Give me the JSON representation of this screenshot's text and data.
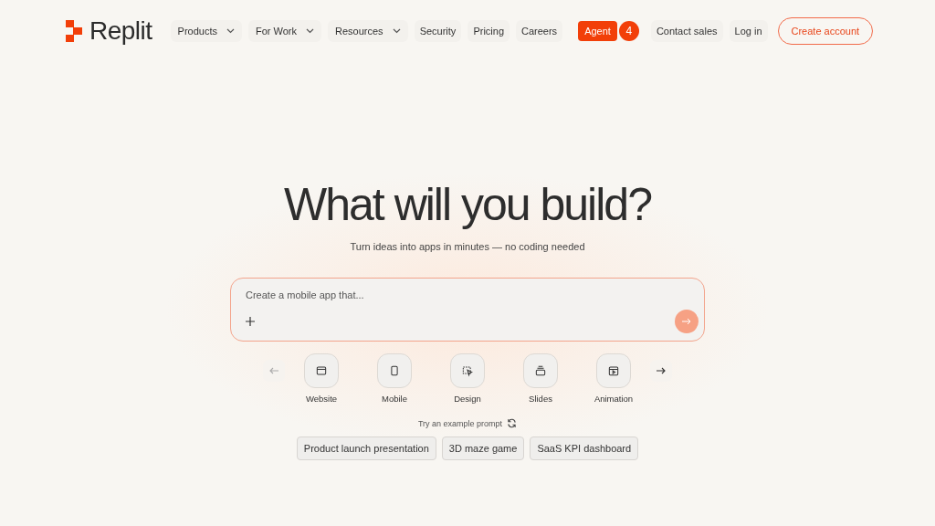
{
  "header": {
    "logo": "Replit",
    "nav": [
      {
        "label": "Products",
        "kind": "dropdown"
      },
      {
        "label": "For Work",
        "kind": "dropdown"
      },
      {
        "label": "Resources",
        "kind": "dropdown"
      },
      {
        "label": "Security",
        "kind": "link"
      },
      {
        "label": "Pricing",
        "kind": "link"
      },
      {
        "label": "Careers",
        "kind": "link"
      }
    ],
    "agent": {
      "label": "Agent",
      "badge": "4"
    },
    "actions": [
      {
        "label": "Contact sales",
        "kind": "link"
      },
      {
        "label": "Log in",
        "kind": "link"
      },
      {
        "label": "Create account",
        "kind": "outline"
      }
    ]
  },
  "hero": {
    "title": "What will you build?",
    "subtitle": "Turn ideas into apps in minutes — no coding needed"
  },
  "prompt": {
    "placeholder": "Create a mobile app that..."
  },
  "carousel": {
    "prev_disabled": true,
    "next_disabled": false,
    "categories": [
      {
        "label": "Website",
        "kind": "website"
      },
      {
        "label": "Mobile",
        "kind": "mobile"
      },
      {
        "label": "Design",
        "kind": "design"
      },
      {
        "label": "Slides",
        "kind": "slides"
      },
      {
        "label": "Animation",
        "kind": "animation"
      }
    ]
  },
  "examples": {
    "label": "Try an example prompt",
    "chips": [
      "Product launch presentation",
      "3D maze game",
      "SaaS KPI dashboard"
    ]
  }
}
